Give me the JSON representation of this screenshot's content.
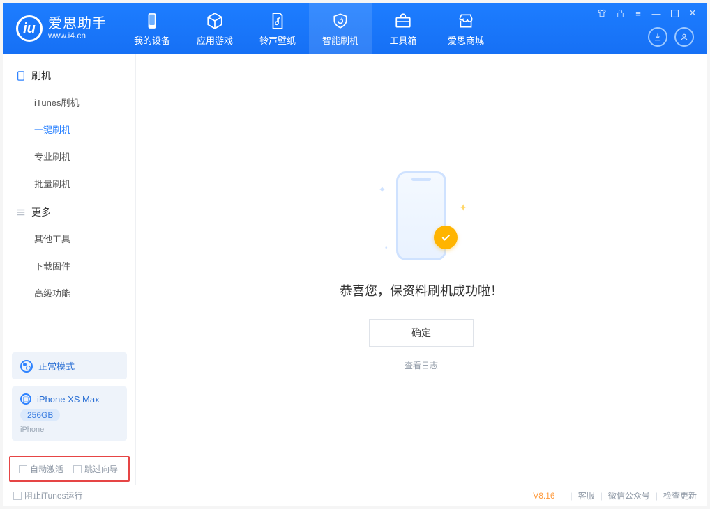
{
  "app": {
    "name": "爱思助手",
    "url": "www.i4.cn"
  },
  "tabs": [
    {
      "label": "我的设备"
    },
    {
      "label": "应用游戏"
    },
    {
      "label": "铃声壁纸"
    },
    {
      "label": "智能刷机"
    },
    {
      "label": "工具箱"
    },
    {
      "label": "爱思商城"
    }
  ],
  "sidebar": {
    "group1": {
      "title": "刷机",
      "items": [
        "iTunes刷机",
        "一键刷机",
        "专业刷机",
        "批量刷机"
      ]
    },
    "group2": {
      "title": "更多",
      "items": [
        "其他工具",
        "下载固件",
        "高级功能"
      ]
    }
  },
  "device": {
    "mode": "正常模式",
    "name": "iPhone XS Max",
    "capacity": "256GB",
    "type": "iPhone"
  },
  "checks": {
    "auto_activate": "自动激活",
    "skip_guide": "跳过向导"
  },
  "main": {
    "message": "恭喜您，保资料刷机成功啦！",
    "ok": "确定",
    "view_log": "查看日志"
  },
  "status": {
    "block_itunes": "阻止iTunes运行",
    "version": "V8.16",
    "links": [
      "客服",
      "微信公众号",
      "检查更新"
    ]
  }
}
